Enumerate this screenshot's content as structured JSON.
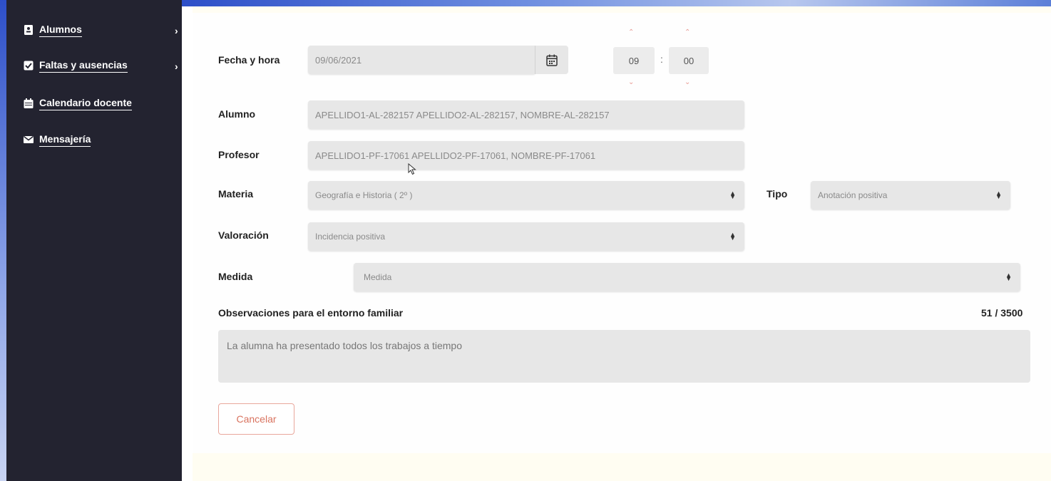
{
  "sidebar": {
    "items": [
      {
        "label": "Alumnos",
        "icon": "contact-card-icon",
        "has_submenu": true
      },
      {
        "label": "Faltas y ausencias",
        "icon": "checkbox-icon",
        "has_submenu": true
      },
      {
        "label": "Calendario docente",
        "icon": "calendar-icon",
        "has_submenu": false
      },
      {
        "label": "Mensajería",
        "icon": "envelope-icon",
        "has_submenu": false
      }
    ],
    "chevron": "›"
  },
  "form": {
    "fecha_label": "Fecha y hora",
    "fecha_value": "09/06/2021",
    "hour": "09",
    "minute": "00",
    "time_separator": ":",
    "alumno_label": "Alumno",
    "alumno_value": "APELLIDO1-AL-282157 APELLIDO2-AL-282157, NOMBRE-AL-282157",
    "profesor_label": "Profesor",
    "profesor_value": "APELLIDO1-PF-17061 APELLIDO2-PF-17061, NOMBRE-PF-17061",
    "materia_label": "Materia",
    "materia_value": "Geografía e Historia ( 2º )",
    "tipo_label": "Tipo",
    "tipo_value": "Anotación positiva",
    "valoracion_label": "Valoración",
    "valoracion_value": "Incidencia positiva",
    "medida_label": "Medida",
    "medida_placeholder": "Medida",
    "observaciones_label": "Observaciones para el entorno familiar",
    "observaciones_value": "La alumna ha presentado todos los trabajos a tiempo",
    "char_counter": "51 / 3500",
    "cancel_label": "Cancelar"
  },
  "colors": {
    "sidebar_bg": "#232330",
    "field_bg": "#e7e7e7",
    "accent": "#d9735f",
    "frame_blue": "#2d4fc8"
  }
}
